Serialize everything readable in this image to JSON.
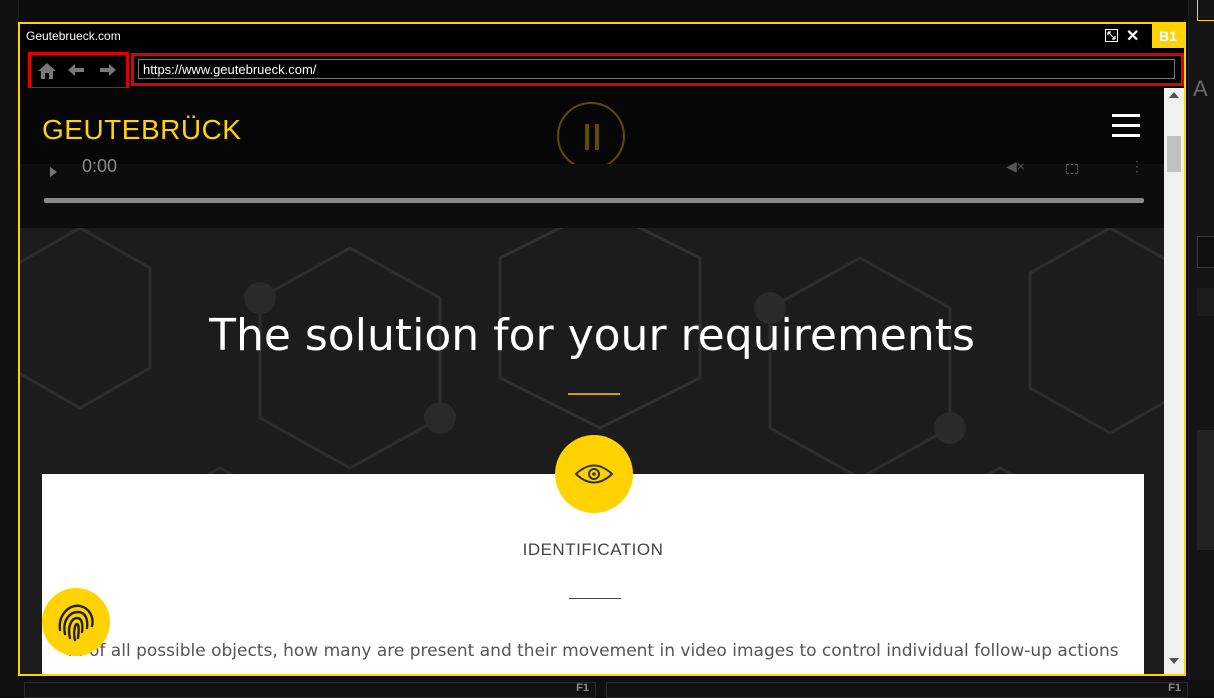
{
  "window": {
    "title": "Geutebrueck.com",
    "badge": "B1"
  },
  "navigation": {
    "url": "https://www.geutebrueck.com/"
  },
  "site": {
    "logo": "GEUTEBRÜCK",
    "video_time": "0:00",
    "hero_heading": "The solution for your requirements",
    "feature": {
      "title": "IDENTIFICATION",
      "description": "... of all possible objects, how many are present and their movement in video images to control individual follow-up actions"
    }
  },
  "app": {
    "right_panel_letter": "A",
    "bottom_pane_left": "F1",
    "bottom_pane_right": "F1"
  },
  "colors": {
    "accent": "#ffd200",
    "highlight_box": "#e00000"
  },
  "icons": [
    "home-icon",
    "back-arrow-icon",
    "forward-arrow-icon",
    "maximize-icon",
    "close-icon",
    "hamburger-menu-icon",
    "pause-icon",
    "play-icon",
    "mute-icon",
    "fullscreen-icon",
    "more-options-icon",
    "eye-icon",
    "fingerprint-icon"
  ]
}
